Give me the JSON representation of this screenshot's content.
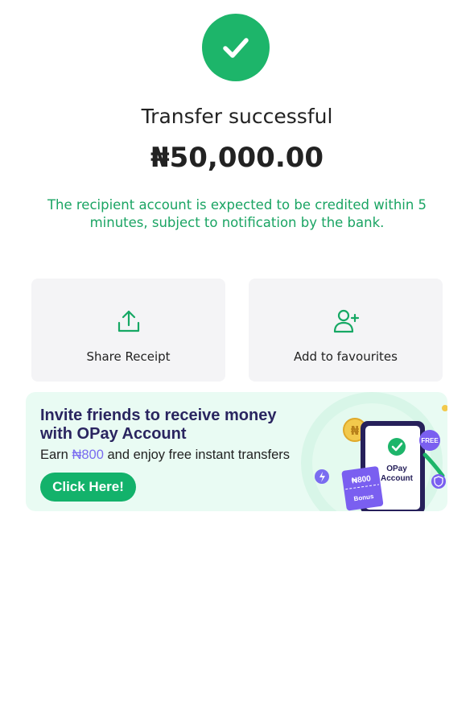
{
  "status": {
    "title": "Transfer successful",
    "amount": "₦50,000.00",
    "note": "The recipient account is expected to be credited within 5 minutes, subject to notification by the bank."
  },
  "actions": [
    {
      "label": "Share Receipt",
      "icon": "share-upload-icon"
    },
    {
      "label": "Add to favourites",
      "icon": "add-user-icon"
    }
  ],
  "banner": {
    "headline": "Invite friends to receive money with OPay Account",
    "sub_prefix": "Earn ",
    "sub_amount": "₦800",
    "sub_suffix": " and enjoy free instant transfers",
    "cta": "Click Here!",
    "art": {
      "free_tag": "FREE",
      "ticket_amount": "₦800",
      "ticket_label": "Bonus",
      "phone_line1": "OPay",
      "phone_line2": "Account",
      "coin_symbol": "₦"
    }
  },
  "colors": {
    "brand_green": "#1db56a",
    "note_green": "#1aa463",
    "banner_bg": "#e9fbf3",
    "accent_purple": "#7a6cf0",
    "headline_navy": "#2a2560"
  }
}
